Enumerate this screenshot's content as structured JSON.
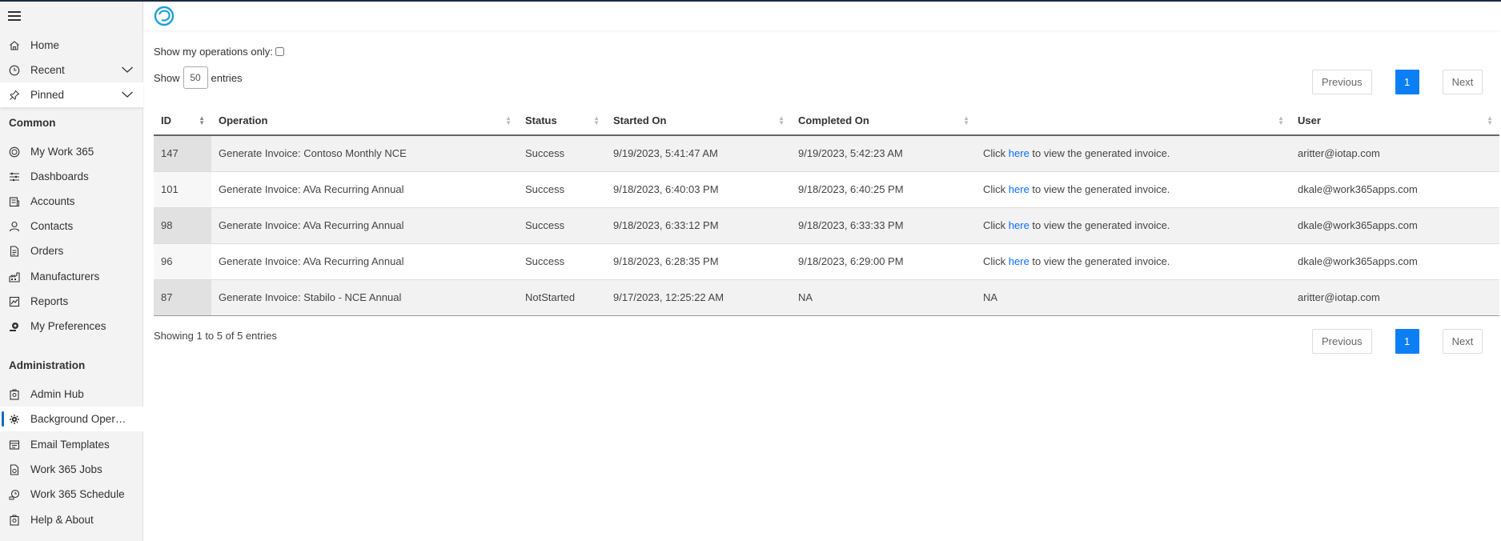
{
  "sidebar": {
    "items_top": [
      {
        "label": "Home",
        "icon": "home-icon"
      },
      {
        "label": "Recent",
        "icon": "clock-icon"
      },
      {
        "label": "Pinned",
        "icon": "pin-icon"
      }
    ],
    "common_title": "Common",
    "common": [
      {
        "label": "My Work 365",
        "icon": "globe-icon"
      },
      {
        "label": "Dashboards",
        "icon": "dashboard-icon"
      },
      {
        "label": "Accounts",
        "icon": "accounts-icon"
      },
      {
        "label": "Contacts",
        "icon": "person-icon"
      },
      {
        "label": "Orders",
        "icon": "document-icon"
      },
      {
        "label": "Manufacturers",
        "icon": "manufacturer-icon"
      },
      {
        "label": "Reports",
        "icon": "chart-icon"
      },
      {
        "label": "My Preferences",
        "icon": "preferences-icon"
      }
    ],
    "admin_title": "Administration",
    "admin": [
      {
        "label": "Admin Hub",
        "icon": "admin-icon"
      },
      {
        "label": "Background Operati...",
        "icon": "gear-icon"
      },
      {
        "label": "Email Templates",
        "icon": "email-icon"
      },
      {
        "label": "Work 365 Jobs",
        "icon": "jobs-icon"
      },
      {
        "label": "Work 365 Schedule",
        "icon": "schedule-icon"
      },
      {
        "label": "Help & About",
        "icon": "help-icon"
      }
    ]
  },
  "filters": {
    "show_mine_label": "Show my operations only:",
    "show_label": "Show",
    "entries_count": "50",
    "entries_label": "entries"
  },
  "pager": {
    "previous": "Previous",
    "page": "1",
    "next": "Next"
  },
  "table": {
    "columns": [
      "ID",
      "Operation",
      "Status",
      "Started On",
      "Completed On",
      "",
      "User"
    ],
    "rows": [
      {
        "id": "147",
        "operation": "Generate Invoice: Contoso Monthly NCE",
        "status": "Success",
        "started": "9/19/2023, 5:41:47 AM",
        "completed": "9/19/2023, 5:42:23 AM",
        "link": true,
        "user": "aritter@iotap.com"
      },
      {
        "id": "101",
        "operation": "Generate Invoice: AVa Recurring Annual",
        "status": "Success",
        "started": "9/18/2023, 6:40:03 PM",
        "completed": "9/18/2023, 6:40:25 PM",
        "link": true,
        "user": "dkale@work365apps.com"
      },
      {
        "id": "98",
        "operation": "Generate Invoice: AVa Recurring Annual",
        "status": "Success",
        "started": "9/18/2023, 6:33:12 PM",
        "completed": "9/18/2023, 6:33:33 PM",
        "link": true,
        "user": "dkale@work365apps.com"
      },
      {
        "id": "96",
        "operation": "Generate Invoice: AVa Recurring Annual",
        "status": "Success",
        "started": "9/18/2023, 6:28:35 PM",
        "completed": "9/18/2023, 6:29:00 PM",
        "link": true,
        "user": "dkale@work365apps.com"
      },
      {
        "id": "87",
        "operation": "Generate Invoice: Stabilo - NCE Annual",
        "status": "NotStarted",
        "started": "9/17/2023, 12:25:22 AM",
        "completed": "NA",
        "link": false,
        "na": "NA",
        "user": "aritter@iotap.com"
      }
    ],
    "link_prefix": "Click ",
    "link_text": "here",
    "link_suffix": " to view the generated invoice."
  },
  "footer": {
    "showing": "Showing 1 to 5 of 5 entries"
  },
  "colors": {
    "accent": "#0d7ff5",
    "link": "#0d6efd"
  }
}
